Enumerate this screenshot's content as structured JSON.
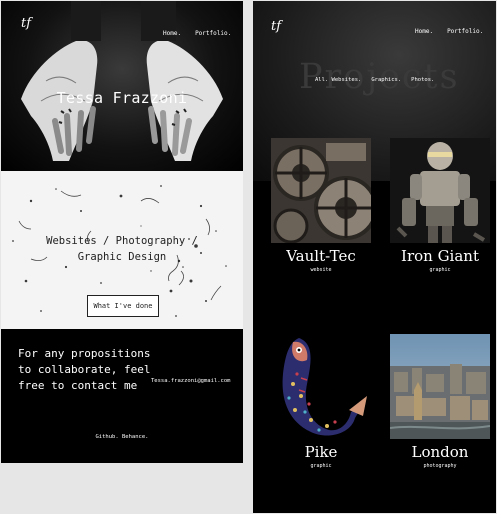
{
  "left_page": {
    "logo": "tf",
    "nav": [
      "Home.",
      "Portfolio."
    ],
    "hero_title": "Tessa Frazzoni",
    "services": {
      "line1": "Websites / Photography /",
      "line2": "Graphic Design",
      "button": "What I've done"
    },
    "contact": {
      "message": "For any propositions to collaborate, feel free to contact me",
      "email": "Tessa.frazzoni@gmail.com",
      "social": [
        "Github.",
        "Behance."
      ]
    }
  },
  "right_page": {
    "logo": "tf",
    "nav": [
      "Home.",
      "Portfolio."
    ],
    "heading": "Projects",
    "filters": [
      "All. Websites.",
      "Graphics.",
      "Photos."
    ],
    "projects": [
      {
        "title": "Vault-Tec",
        "category": "website",
        "thumb": "gears-icon"
      },
      {
        "title": "Iron Giant",
        "category": "graphic",
        "thumb": "robot-icon"
      },
      {
        "title": "Pike",
        "category": "graphic",
        "thumb": "fish-icon"
      },
      {
        "title": "London",
        "category": "photography",
        "thumb": "city-icon"
      }
    ]
  },
  "colors": {
    "page_bg": "#e6e6e6",
    "dark_bg": "#000000",
    "light_section": "#f4f4f4",
    "text_light": "#ffffff",
    "heading_ghost": "#3a3a3a"
  }
}
